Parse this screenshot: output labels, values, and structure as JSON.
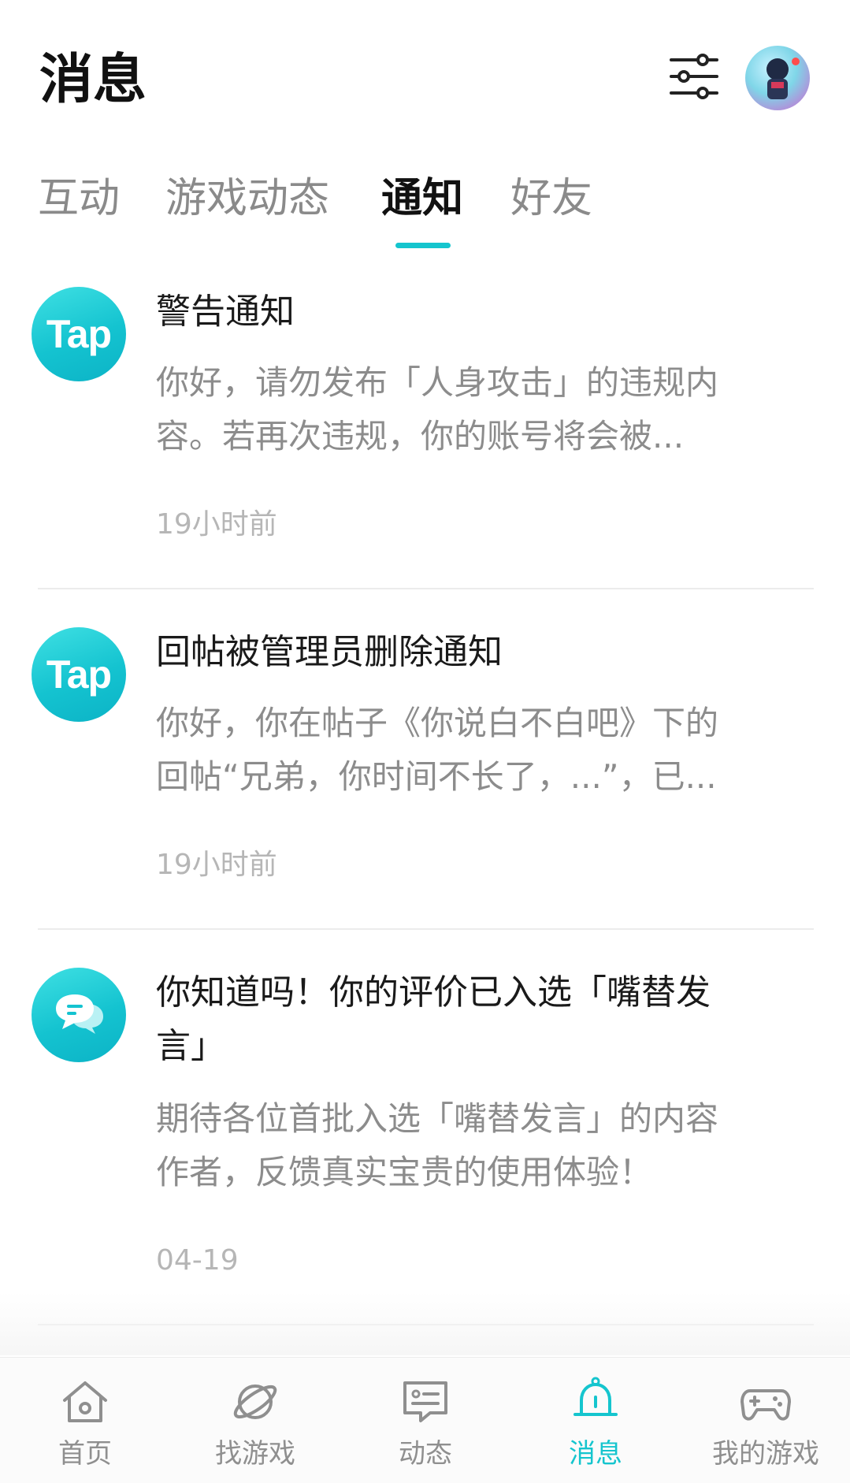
{
  "header": {
    "title": "消息"
  },
  "tabs": [
    {
      "label": "互动",
      "active": false
    },
    {
      "label": "游戏动态",
      "active": false
    },
    {
      "label": "通知",
      "active": true
    },
    {
      "label": "好友",
      "active": false
    }
  ],
  "notifications": [
    {
      "icon": "tap-logo-icon",
      "icon_text": "Tap",
      "title": "警告通知",
      "body_lines": [
        "你好，请勿发布「人身攻击」的违规内",
        "容。若再次违规，你的账号将会被..."
      ],
      "time": "19小时前"
    },
    {
      "icon": "tap-logo-icon",
      "icon_text": "Tap",
      "title": "回帖被管理员删除通知",
      "body_lines": [
        "你好，你在帖子《你说白不白吧》下的",
        "回帖“兄弟，你时间不长了，...”，已..."
      ],
      "time": "19小时前"
    },
    {
      "icon": "chat-bubble-icon",
      "title_lines": [
        "你知道吗！你的评价已入选「嘴替发",
        "言」"
      ],
      "body_lines": [
        "期待各位首批入选「嘴替发言」的内容",
        "作者，反馈真实宝贵的使用体验！"
      ],
      "time": "04-19"
    }
  ],
  "bottom_nav": [
    {
      "label": "首页",
      "icon": "home-icon",
      "active": false
    },
    {
      "label": "找游戏",
      "icon": "planet-icon",
      "active": false
    },
    {
      "label": "动态",
      "icon": "feed-icon",
      "active": false
    },
    {
      "label": "消息",
      "icon": "bell-icon",
      "active": true
    },
    {
      "label": "我的游戏",
      "icon": "gamepad-icon",
      "active": false
    }
  ],
  "colors": {
    "accent": "#15c5ce",
    "text_primary": "#1a1a1a",
    "text_secondary": "#8c8c8c",
    "text_muted": "#b6b6b6"
  }
}
